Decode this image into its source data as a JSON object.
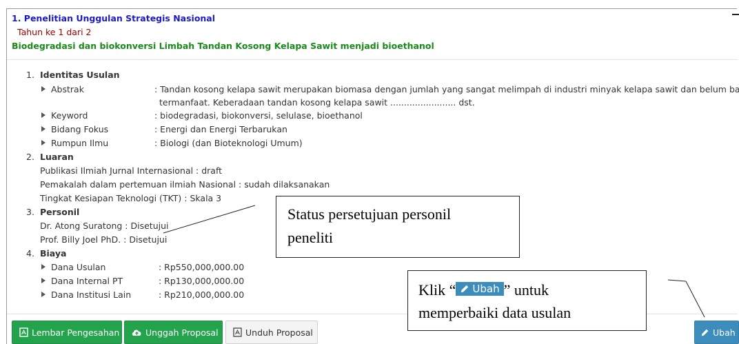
{
  "header": {
    "title": "1. Penelitian Unggulan Strategis Nasional",
    "year": "Tahun ke 1 dari 2",
    "subtitle": "Biodegradasi dan biokonversi Limbah Tandan Kosong Kelapa Sawit menjadi bioethanol"
  },
  "identitas": {
    "num": "1.",
    "title": "Identitas Usulan",
    "items": [
      {
        "label": "Abstrak",
        "value": ": Tandan kosong kelapa sawit merupakan biomasa dengan jumlah yang sangat melimpah di industri minyak kelapa sawit dan belum banyak",
        "value2": "termanfaat. Keberadaan tandan kosong kelapa sawit ........................ dst."
      },
      {
        "label": "Keyword",
        "value": ": biodegradasi, biokonversi, selulase, bioethanol"
      },
      {
        "label": "Bidang Fokus",
        "value": ": Energi dan Energi Terbarukan"
      },
      {
        "label": "Rumpun Ilmu",
        "value": ": Biologi (dan Bioteknologi Umum)"
      }
    ]
  },
  "luaran": {
    "num": "2.",
    "title": "Luaran",
    "lines": [
      "Publikasi Ilmiah Jurnal Internasional : draft",
      "Pemakalah dalam pertemuan ilmiah Nasional : sudah dilaksanakan",
      "Tingkat Kesiapan Teknologi (TKT) : Skala 3"
    ]
  },
  "personil": {
    "num": "3.",
    "title": "Personil",
    "lines": [
      "Dr. Atong Suratong : Disetujui",
      "Prof. Billy Joel PhD. : Disetujui"
    ]
  },
  "biaya": {
    "num": "4.",
    "title": "Biaya",
    "items": [
      {
        "label": "Dana Usulan",
        "value": ": Rp550,000,000.00"
      },
      {
        "label": "Dana Internal PT",
        "value": ": Rp130,000,000.00"
      },
      {
        "label": "Dana Institusi Lain",
        "value": ": Rp210,000,000.00"
      }
    ]
  },
  "callouts": {
    "personil_line1": "Status persetujuan personil",
    "personil_line2": "peneliti",
    "ubah_prefix": "Klik “",
    "ubah_inline": "Ubah",
    "ubah_suffix": "” untuk",
    "ubah_line2": "memperbaiki data usulan"
  },
  "buttons": {
    "lembar": "Lembar Pengesahan",
    "unggah": "Unggah Proposal",
    "unduh": "Unduh Proposal",
    "ubah": "Ubah"
  },
  "colors": {
    "title_blue": "#1a1acc",
    "year_red": "#a00000",
    "subtitle_green": "#1a8a1a",
    "button_green": "#24a34d",
    "button_blue": "#3c8dbc"
  }
}
